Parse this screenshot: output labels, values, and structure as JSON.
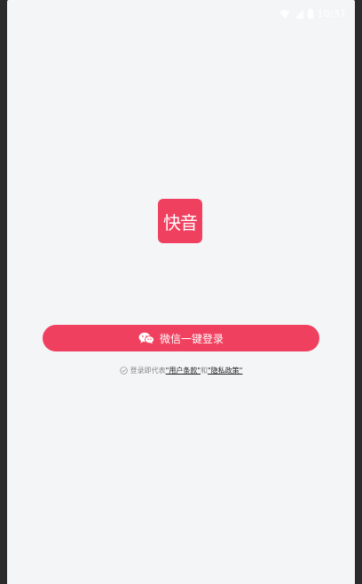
{
  "status_bar": {
    "time": "10:37",
    "icons": [
      "wifi-icon",
      "signal-icon",
      "battery-icon"
    ]
  },
  "app": {
    "logo_text": "快音",
    "brand_color": "#f0405f"
  },
  "login": {
    "wechat_button_label": "微信一键登录",
    "icon": "wechat-icon"
  },
  "agreement": {
    "prefix": "登录即代表",
    "user_terms": "\"用户条款\"",
    "conjunction": "和",
    "privacy_policy": "\"隐私政策\""
  },
  "colors": {
    "background": "#f4f5f7",
    "accent": "#f0405f",
    "text_muted": "#888888"
  }
}
